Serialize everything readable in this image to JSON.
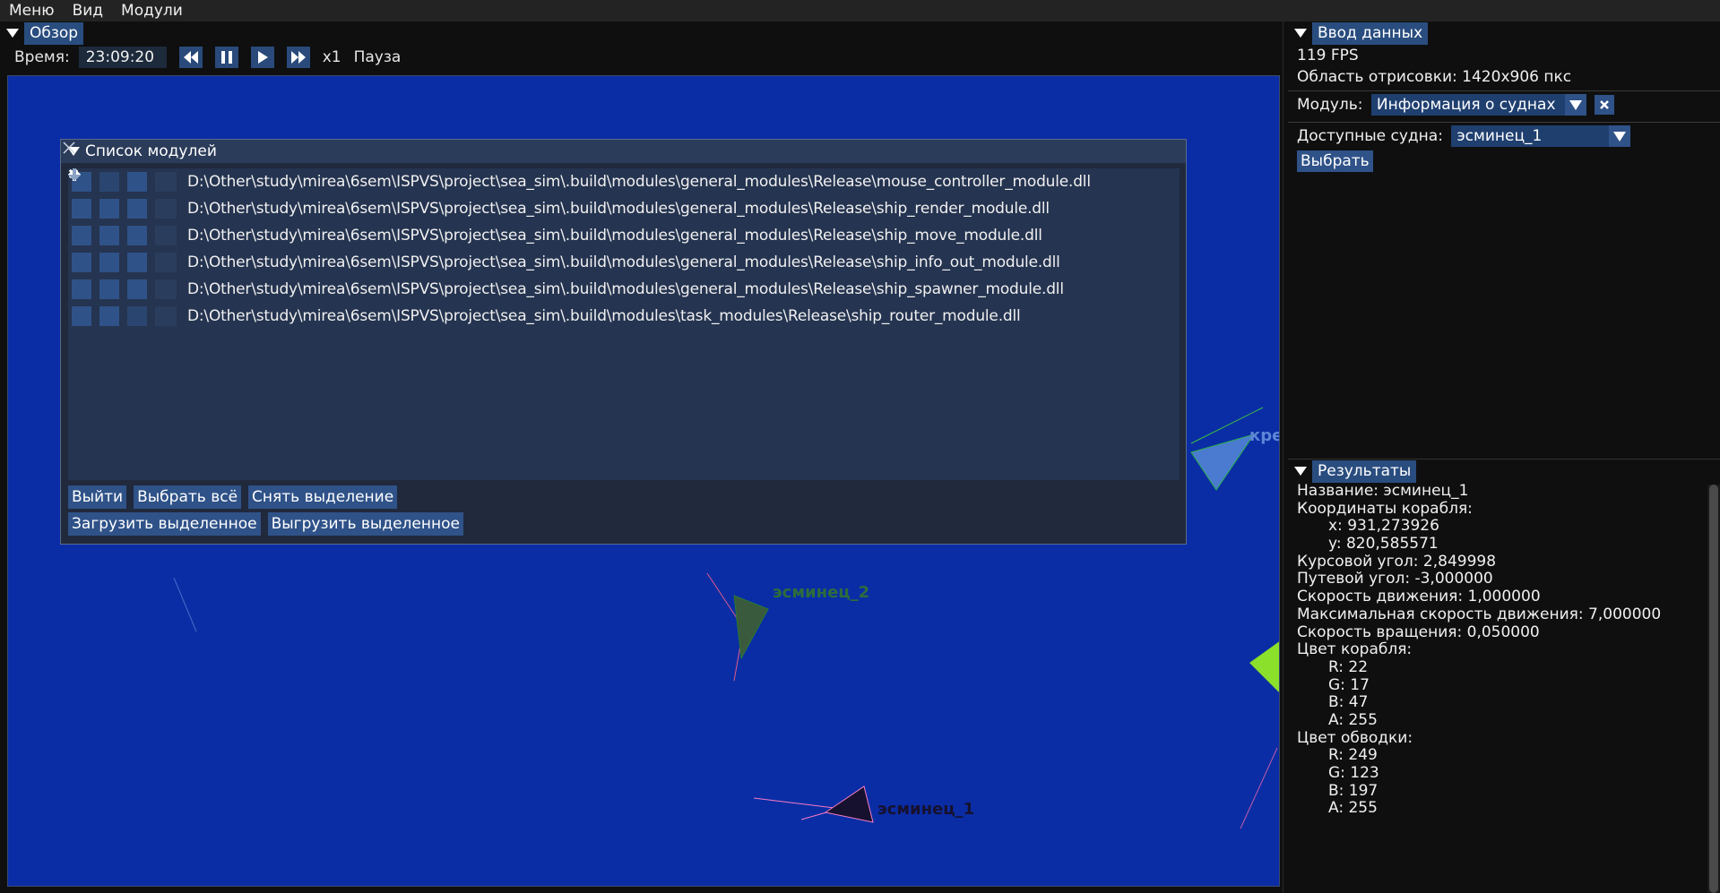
{
  "menubar": {
    "items": [
      "Меню",
      "Вид",
      "Модули"
    ]
  },
  "overview": {
    "title": "Обзор",
    "time_label": "Время:",
    "time_value": "23:09:20",
    "speed": "x1",
    "state": "Пауза",
    "ships": [
      {
        "label": "кре"
      },
      {
        "label": "эсминец_2"
      },
      {
        "label": "эсминец_1"
      }
    ]
  },
  "modules_window": {
    "title": "Список модулей",
    "items": [
      "D:\\Other\\study\\mirea\\6sem\\ISPVS\\project\\sea_sim\\.build\\modules\\general_modules\\Release\\mouse_controller_module.dll",
      "D:\\Other\\study\\mirea\\6sem\\ISPVS\\project\\sea_sim\\.build\\modules\\general_modules\\Release\\ship_render_module.dll",
      "D:\\Other\\study\\mirea\\6sem\\ISPVS\\project\\sea_sim\\.build\\modules\\general_modules\\Release\\ship_move_module.dll",
      "D:\\Other\\study\\mirea\\6sem\\ISPVS\\project\\sea_sim\\.build\\modules\\general_modules\\Release\\ship_info_out_module.dll",
      "D:\\Other\\study\\mirea\\6sem\\ISPVS\\project\\sea_sim\\.build\\modules\\general_modules\\Release\\ship_spawner_module.dll",
      "D:\\Other\\study\\mirea\\6sem\\ISPVS\\project\\sea_sim\\.build\\modules\\task_modules\\Release\\ship_router_module.dll"
    ],
    "buttons": {
      "exit": "Выйти",
      "select_all": "Выбрать всё",
      "deselect": "Снять выделение",
      "load_selected": "Загрузить выделенное",
      "unload_selected": "Выгрузить выделенное"
    }
  },
  "input_panel": {
    "title": "Ввод данных",
    "fps": "119 FPS",
    "render_area": "Область отрисовки: 1420x906 пкс",
    "module_label": "Модуль:",
    "module_value": "Информация о суднах",
    "ships_label": "Доступные судна:",
    "ships_value": "эсминец_1",
    "select_button": "Выбрать"
  },
  "results_panel": {
    "title": "Результаты",
    "lines": [
      {
        "text": "Название: эсминец_1",
        "indent": false
      },
      {
        "text": "Координаты корабля:",
        "indent": false
      },
      {
        "text": "x: 931,273926",
        "indent": true
      },
      {
        "text": "y: 820,585571",
        "indent": true
      },
      {
        "text": "Курсовой угол: 2,849998",
        "indent": false
      },
      {
        "text": "Путевой угол: -3,000000",
        "indent": false
      },
      {
        "text": "Скорость движения: 1,000000",
        "indent": false
      },
      {
        "text": "Максимальная скорость движения: 7,000000",
        "indent": false
      },
      {
        "text": "Скорость вращения: 0,050000",
        "indent": false
      },
      {
        "text": "Цвет корабля:",
        "indent": false
      },
      {
        "text": "R: 22",
        "indent": true
      },
      {
        "text": "G: 17",
        "indent": true
      },
      {
        "text": "B: 47",
        "indent": true
      },
      {
        "text": "A: 255",
        "indent": true
      },
      {
        "text": "Цвет обводки:",
        "indent": false
      },
      {
        "text": "R: 249",
        "indent": true
      },
      {
        "text": "G: 123",
        "indent": true
      },
      {
        "text": "B: 197",
        "indent": true
      },
      {
        "text": "A: 255",
        "indent": true
      }
    ]
  },
  "colors": {
    "canvas_bg": "#0a2da5",
    "accent": "#2f5288",
    "ship1_fill": "#16112f",
    "ship1_stroke": "#f97bc5"
  }
}
